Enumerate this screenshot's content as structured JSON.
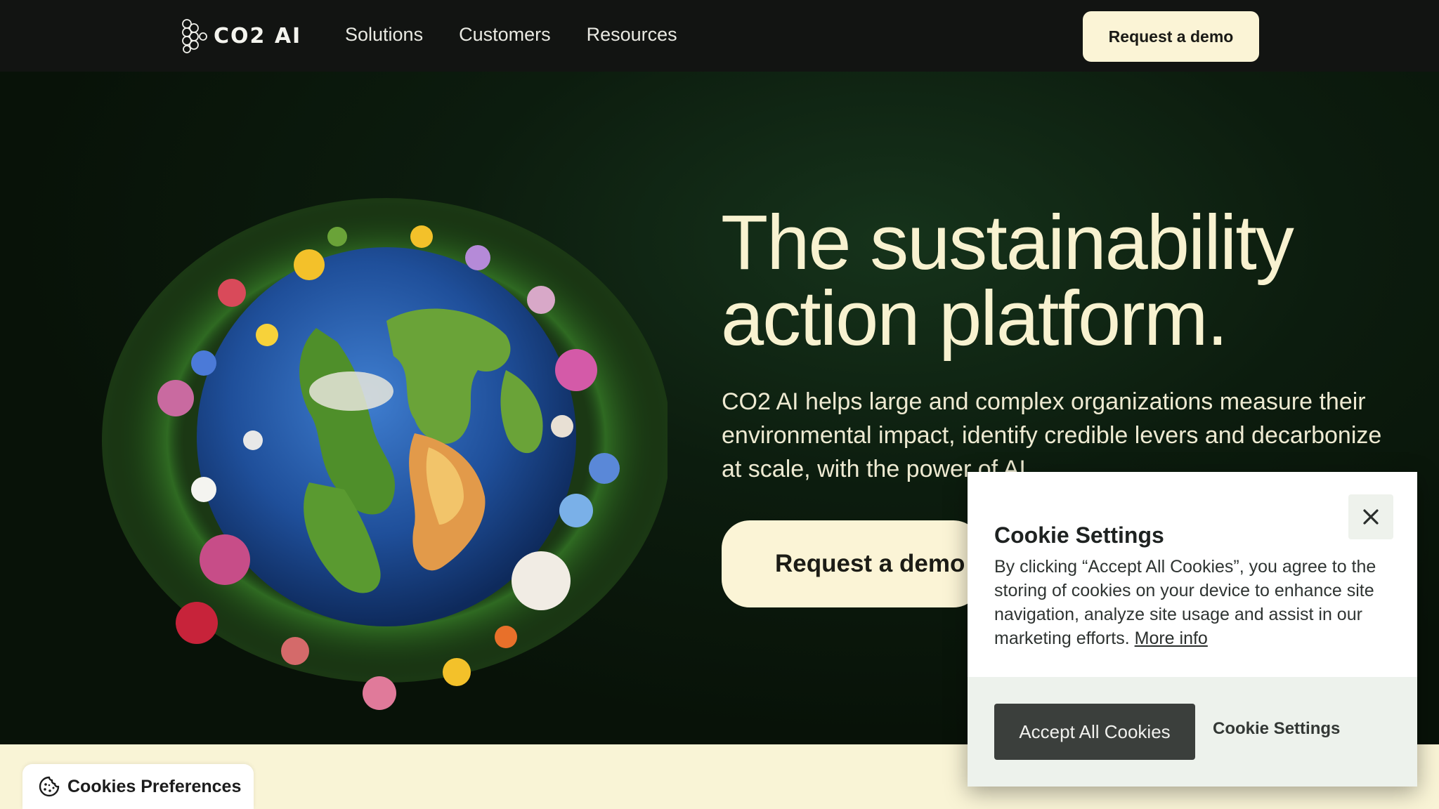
{
  "nav": {
    "logo_text": "CO2 AI",
    "links": [
      "Solutions",
      "Customers",
      "Resources"
    ],
    "cta_label": "Request a demo"
  },
  "hero": {
    "title_line1": "The sustainability",
    "title_line2": "action platform.",
    "subtitle": "CO2 AI helps large and complex organizations measure their environmental impact, identify credible levers and decarbonize at scale, with the power of AI.",
    "cta_label": "Request a demo"
  },
  "cookie_modal": {
    "title": "Cookie Settings",
    "body": "By clicking “Accept All Cookies”, you agree to the storing of cookies on your device to enhance site navigation, analyze site usage and assist in our marketing efforts. ",
    "more_info": "More info",
    "accept_label": "Accept All Cookies",
    "settings_label": "Cookie Settings"
  },
  "cookie_preferences": {
    "label": "Cookies Preferences"
  },
  "colors": {
    "cream": "#fbf4d6",
    "nav_bg": "#121412",
    "hero_bg": "#081408",
    "accept_bg": "#3b3f3c",
    "cookie_footer_bg": "#edf2ec"
  }
}
